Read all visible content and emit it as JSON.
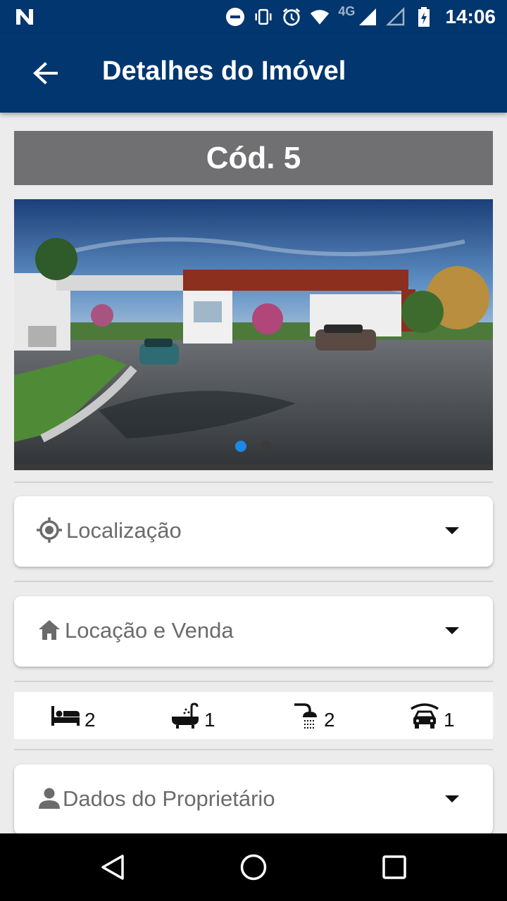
{
  "status_bar": {
    "network": "4G",
    "time": "14:06",
    "icons": [
      "n-notification-icon",
      "do-not-disturb-icon",
      "vibrate-icon",
      "alarm-icon",
      "wifi-icon",
      "signal-icon",
      "signal-empty-icon",
      "battery-charging-icon"
    ]
  },
  "app_bar": {
    "title": "Detalhes do Imóvel",
    "back_icon": "arrow-back-icon"
  },
  "property": {
    "code_label": "Cód. 5"
  },
  "carousel": {
    "image_count": 2,
    "active_index": 0
  },
  "sections": {
    "location": {
      "label": "Localização",
      "icon": "location-target-icon"
    },
    "rent_sale": {
      "label": "Locação e Venda",
      "icon": "home-icon"
    },
    "owner": {
      "label": "Dados do Proprietário",
      "icon": "person-icon"
    }
  },
  "features": [
    {
      "icon": "bed-icon",
      "value": "2"
    },
    {
      "icon": "bathtub-icon",
      "value": "1"
    },
    {
      "icon": "shower-icon",
      "value": "2"
    },
    {
      "icon": "garage-car-icon",
      "value": "1"
    }
  ],
  "colors": {
    "primary": "#02366e",
    "code_banner": "#707072",
    "dot_active": "#1e88e5"
  }
}
